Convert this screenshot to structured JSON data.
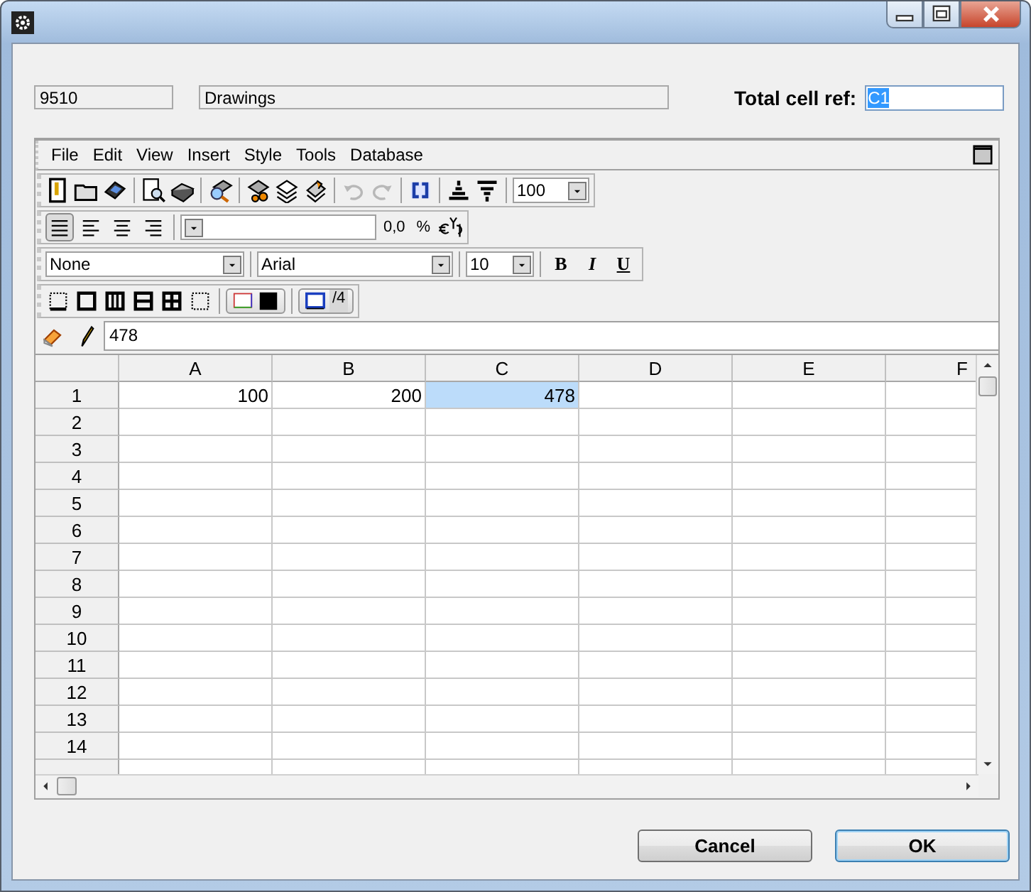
{
  "header": {
    "code": "9510",
    "name": "Drawings",
    "total_label": "Total cell ref:",
    "total_value": "C1"
  },
  "spreadsheet": {
    "menu": [
      "File",
      "Edit",
      "View",
      "Insert",
      "Style",
      "Tools",
      "Database"
    ],
    "history": [
      {
        "kind": "undo",
        "disabled": true
      },
      {
        "kind": "redo",
        "disabled": true
      }
    ],
    "zoom": "100",
    "align_buttons": [
      {
        "kind": "justify",
        "selected": true
      },
      {
        "kind": "left",
        "selected": false
      },
      {
        "kind": "center",
        "selected": false
      },
      {
        "kind": "right",
        "selected": false
      }
    ],
    "number_buttons": [
      "0,0",
      "%"
    ],
    "style": "None",
    "font": "Arial",
    "size": "10",
    "format_buttons": [
      {
        "kind": "bold",
        "label": "B"
      },
      {
        "kind": "italic",
        "label": "I"
      },
      {
        "kind": "underline",
        "label": "U"
      }
    ],
    "border_width": "/4",
    "formula": "478",
    "columns": [
      "A",
      "B",
      "C",
      "D",
      "E",
      "F"
    ],
    "rows": [
      {
        "label": "1",
        "cells": [
          {
            "value": "100",
            "selected": false
          },
          {
            "value": "200",
            "selected": false
          },
          {
            "value": "478",
            "selected": true
          }
        ]
      },
      {
        "label": "2"
      },
      {
        "label": "3"
      },
      {
        "label": "4"
      },
      {
        "label": "5"
      },
      {
        "label": "6"
      },
      {
        "label": "7"
      },
      {
        "label": "8"
      },
      {
        "label": "9"
      },
      {
        "label": "10"
      },
      {
        "label": "11"
      },
      {
        "label": "12"
      },
      {
        "label": "13"
      },
      {
        "label": "14"
      }
    ]
  },
  "buttons": [
    {
      "label": "Cancel",
      "default": false
    },
    {
      "label": "OK",
      "default": true
    }
  ]
}
